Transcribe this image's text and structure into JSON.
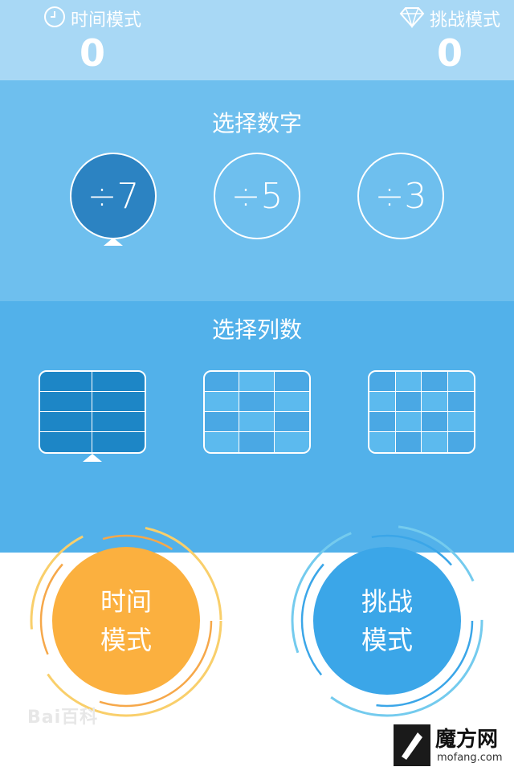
{
  "header": {
    "time_mode": {
      "icon": "clock-icon",
      "label": "时间模式",
      "score": "0"
    },
    "challenge_mode": {
      "icon": "diamond-icon",
      "label": "挑战模式",
      "score": "0"
    }
  },
  "number_section": {
    "title": "选择数字",
    "options": [
      {
        "label": "÷7",
        "selected": true
      },
      {
        "label": "÷5",
        "selected": false
      },
      {
        "label": "÷3",
        "selected": false
      }
    ]
  },
  "column_section": {
    "title": "选择列数",
    "options": [
      {
        "columns": 2,
        "rows": 4,
        "selected": true
      },
      {
        "columns": 3,
        "rows": 4,
        "selected": false
      },
      {
        "columns": 4,
        "rows": 4,
        "selected": false
      }
    ]
  },
  "modes": {
    "time": {
      "line1": "时间",
      "line2": "模式"
    },
    "challenge": {
      "line1": "挑战",
      "line2": "模式"
    }
  },
  "watermarks": {
    "baidu": "Bai百科",
    "mofang_cn": "魔方网",
    "mofang_en": "mofang.com"
  },
  "colors": {
    "header_bg": "#a8d8f5",
    "number_bg": "#6ebfee",
    "column_bg": "#52b1ea",
    "selected": "#2c83c2",
    "time_mode": "#fbb03f",
    "challenge_mode": "#3ba6e8"
  }
}
